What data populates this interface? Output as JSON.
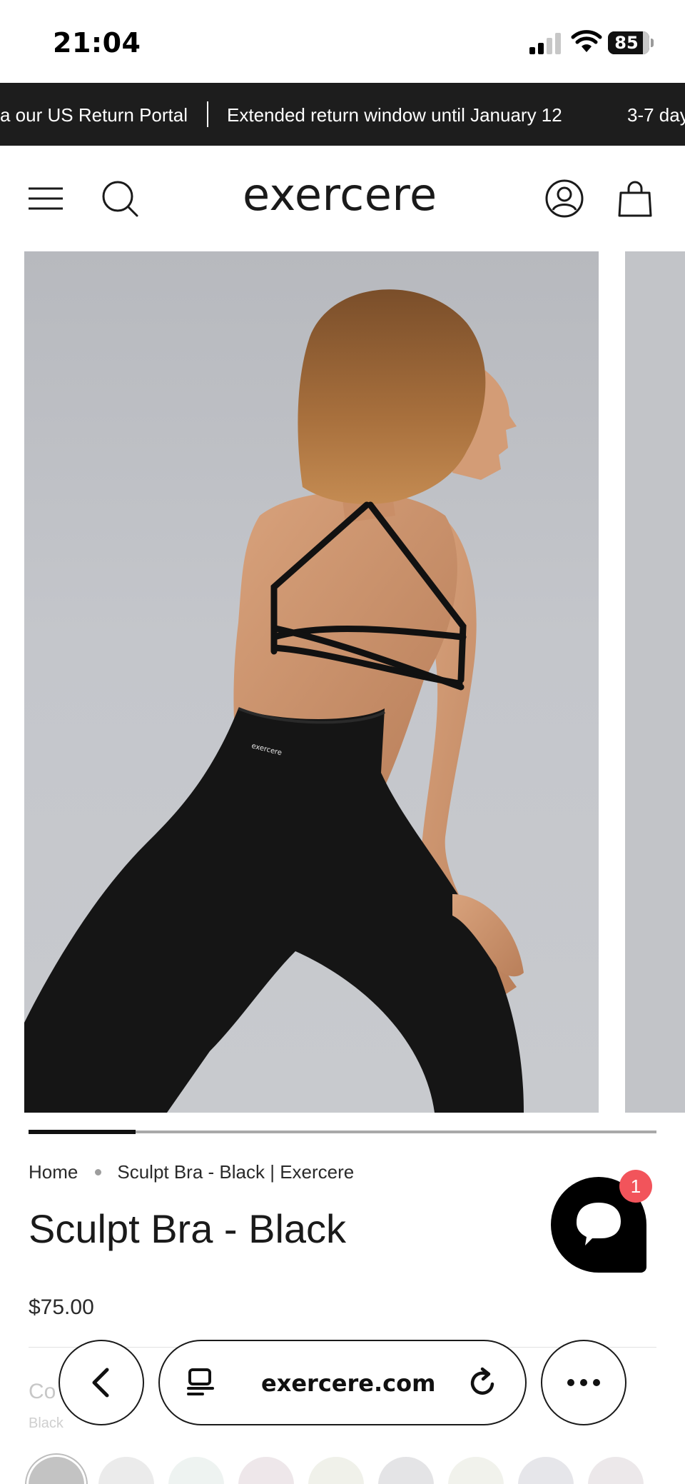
{
  "status_bar": {
    "time": "21:04",
    "battery_level": "85",
    "battery_fraction": 0.85
  },
  "announcement_bar": {
    "items": [
      "a our US Return Portal",
      "Extended return window until January 12",
      "3-7 day"
    ]
  },
  "header": {
    "logo_text": "exercere",
    "icons": [
      "menu-icon",
      "search-icon",
      "account-icon",
      "bag-icon"
    ]
  },
  "gallery": {
    "logo_on_garment": "exercere",
    "progress_fraction": 0.17
  },
  "breadcrumb": {
    "home": "Home",
    "current": "Sculpt Bra - Black | Exercere"
  },
  "product": {
    "title": "Sculpt Bra - Black",
    "price": "$75.00",
    "color_label": "Co",
    "color_value": "Black"
  },
  "swatches": [
    {
      "name": "Black",
      "color": "#c3c3c3"
    },
    {
      "name": "swatch-2",
      "color": "#ebebeb"
    },
    {
      "name": "swatch-3",
      "color": "#eef3f1"
    },
    {
      "name": "swatch-4",
      "color": "#eee7ea"
    },
    {
      "name": "swatch-5",
      "color": "#f0f1ea"
    },
    {
      "name": "swatch-6",
      "color": "#e4e4e6"
    },
    {
      "name": "swatch-7",
      "color": "#f1f2ec"
    },
    {
      "name": "swatch-8",
      "color": "#e6e6ea"
    },
    {
      "name": "swatch-9",
      "color": "#ece8ea"
    }
  ],
  "chat": {
    "badge_count": "1"
  },
  "browser_toolbar": {
    "url": "exercere.com"
  },
  "colors": {
    "announcement_bg": "#1d1d1d",
    "chat_badge": "#f2545b",
    "text": "#1c1c1c"
  }
}
